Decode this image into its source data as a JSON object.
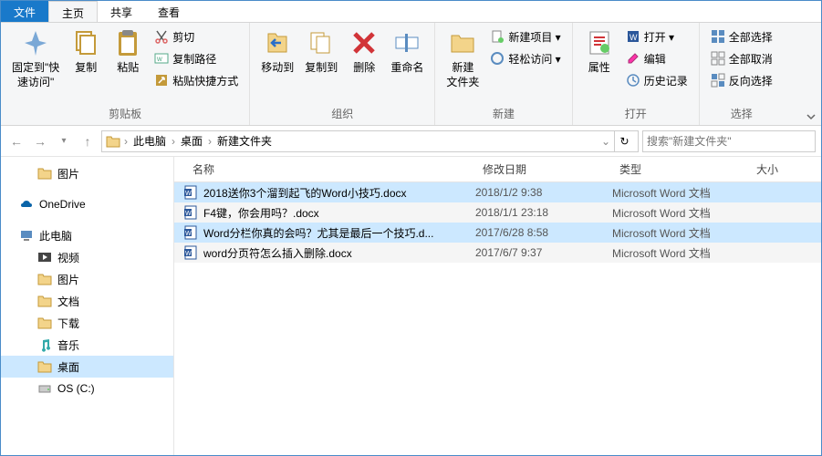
{
  "tabs": {
    "file": "文件",
    "home": "主页",
    "share": "共享",
    "view": "查看"
  },
  "ribbon": {
    "clipboard": {
      "label": "剪贴板",
      "pin": "固定到\"快\n速访问\"",
      "copy": "复制",
      "paste": "粘贴",
      "cut": "剪切",
      "copypath": "复制路径",
      "pasteshortcut": "粘贴快捷方式"
    },
    "organize": {
      "label": "组织",
      "moveto": "移动到",
      "copyto": "复制到",
      "delete": "删除",
      "rename": "重命名"
    },
    "new": {
      "label": "新建",
      "newfolder": "新建\n文件夹",
      "newitem": "新建项目 ▾",
      "easyaccess": "轻松访问 ▾"
    },
    "open": {
      "label": "打开",
      "properties": "属性",
      "open": "打开 ▾",
      "edit": "编辑",
      "history": "历史记录"
    },
    "select": {
      "label": "选择",
      "selectall": "全部选择",
      "selectnone": "全部取消",
      "invert": "反向选择"
    }
  },
  "nav": {
    "crumbs": [
      "此电脑",
      "桌面",
      "新建文件夹"
    ],
    "search_placeholder": "搜索\"新建文件夹\""
  },
  "sidebar": {
    "items": [
      {
        "label": "图片",
        "icon": "folder",
        "level": 2
      },
      {
        "label": "",
        "spacer": true
      },
      {
        "label": "OneDrive",
        "icon": "onedrive",
        "level": 1
      },
      {
        "label": "",
        "spacer": true
      },
      {
        "label": "此电脑",
        "icon": "pc",
        "level": 1
      },
      {
        "label": "视频",
        "icon": "video",
        "level": 2
      },
      {
        "label": "图片",
        "icon": "folder",
        "level": 2
      },
      {
        "label": "文档",
        "icon": "folder",
        "level": 2
      },
      {
        "label": "下载",
        "icon": "folder",
        "level": 2
      },
      {
        "label": "音乐",
        "icon": "music",
        "level": 2
      },
      {
        "label": "桌面",
        "icon": "folder",
        "level": 2,
        "selected": true
      },
      {
        "label": "OS (C:)",
        "icon": "drive",
        "level": 2
      }
    ]
  },
  "columns": {
    "name": "名称",
    "date": "修改日期",
    "type": "类型",
    "size": "大小"
  },
  "files": [
    {
      "name": "2018送你3个溜到起飞的Word小技巧.docx",
      "date": "2018/1/2 9:38",
      "type": "Microsoft Word 文档",
      "selected": true
    },
    {
      "name": "F4键，你会用吗？.docx",
      "date": "2018/1/1 23:18",
      "type": "Microsoft Word 文档"
    },
    {
      "name": "Word分栏你真的会吗？尤其是最后一个技巧.d...",
      "date": "2017/6/28 8:58",
      "type": "Microsoft Word 文档",
      "selected": true
    },
    {
      "name": "word分页符怎么插入删除.docx",
      "date": "2017/6/7 9:37",
      "type": "Microsoft Word 文档"
    }
  ]
}
